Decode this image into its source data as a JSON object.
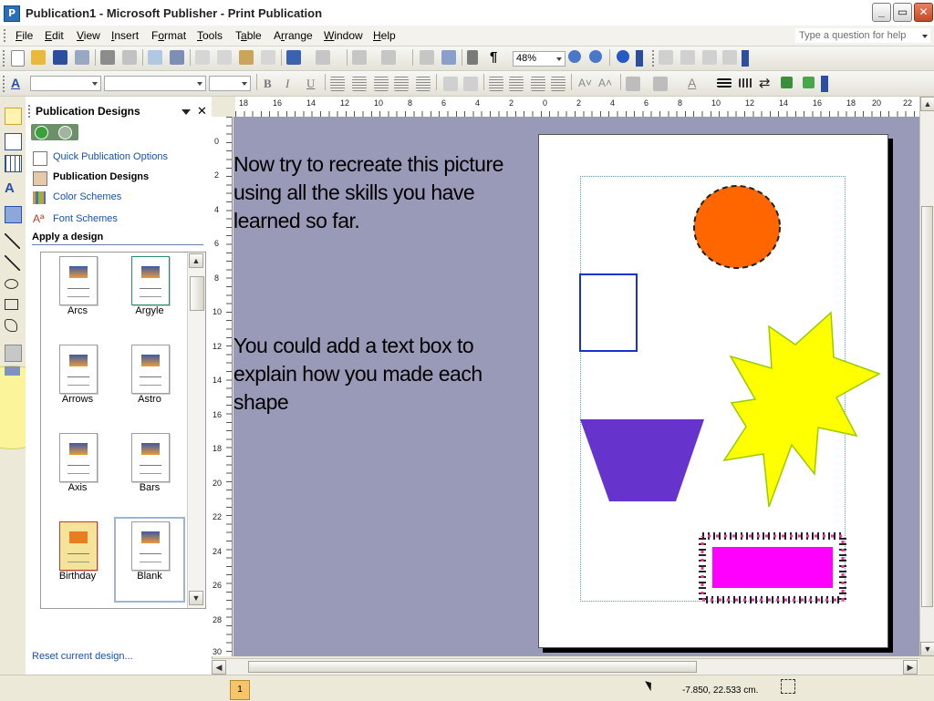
{
  "window": {
    "title": "Publication1 - Microsoft Publisher - Print Publication",
    "app_icon_letter": "P",
    "minimize_glyph": "_",
    "restore_glyph": "▭",
    "close_glyph": "✕"
  },
  "menu": {
    "items": [
      "File",
      "Edit",
      "View",
      "Insert",
      "Format",
      "Tools",
      "Table",
      "Arrange",
      "Window",
      "Help"
    ],
    "access_keys": [
      "F",
      "E",
      "V",
      "I",
      "o",
      "T",
      "a",
      "r",
      "W",
      "H"
    ],
    "help_placeholder": "Type a question for help"
  },
  "toolbar": {
    "zoom_value": "48%"
  },
  "task_pane": {
    "title": "Publication Designs",
    "links": [
      "Quick Publication Options",
      "Publication Designs",
      "Color Schemes",
      "Font Schemes"
    ],
    "section_title": "Apply a design",
    "designs": [
      "Arcs",
      "Argyle",
      "Arrows",
      "Astro",
      "Axis",
      "Bars",
      "Birthday",
      "Blank"
    ],
    "selected_design": "Blank",
    "reset_link": "Reset current design..."
  },
  "ruler": {
    "h_labels": [
      "18",
      "16",
      "14",
      "12",
      "10",
      "8",
      "6",
      "4",
      "2",
      "0",
      "2",
      "4",
      "6",
      "8",
      "10",
      "12",
      "14",
      "16",
      "18",
      "20",
      "22"
    ],
    "v_labels": [
      "0",
      "2",
      "4",
      "6",
      "8",
      "10",
      "12",
      "14",
      "16",
      "18",
      "20",
      "22",
      "24",
      "26",
      "28",
      "30"
    ]
  },
  "canvas": {
    "text_block_1": [
      "Now try to recreate this picture",
      "using all the skills you have",
      "learned so far."
    ],
    "text_block_2": [
      "You could add a text box to",
      "explain how you made each",
      "shape"
    ],
    "shapes": [
      {
        "type": "oval",
        "fill": "#ff6600",
        "border": "dashed"
      },
      {
        "type": "rectangle",
        "fill": "none",
        "stroke": "#1a33cc"
      },
      {
        "type": "trapezoid",
        "fill": "#6633cc"
      },
      {
        "type": "explosion",
        "fill": "#ffff00",
        "stroke": "#99cc00"
      },
      {
        "type": "rectangle",
        "fill": "#ff00ff",
        "border": "art-border"
      }
    ]
  },
  "status": {
    "page_number": "1",
    "position": "-7.850, 22.533 cm."
  }
}
